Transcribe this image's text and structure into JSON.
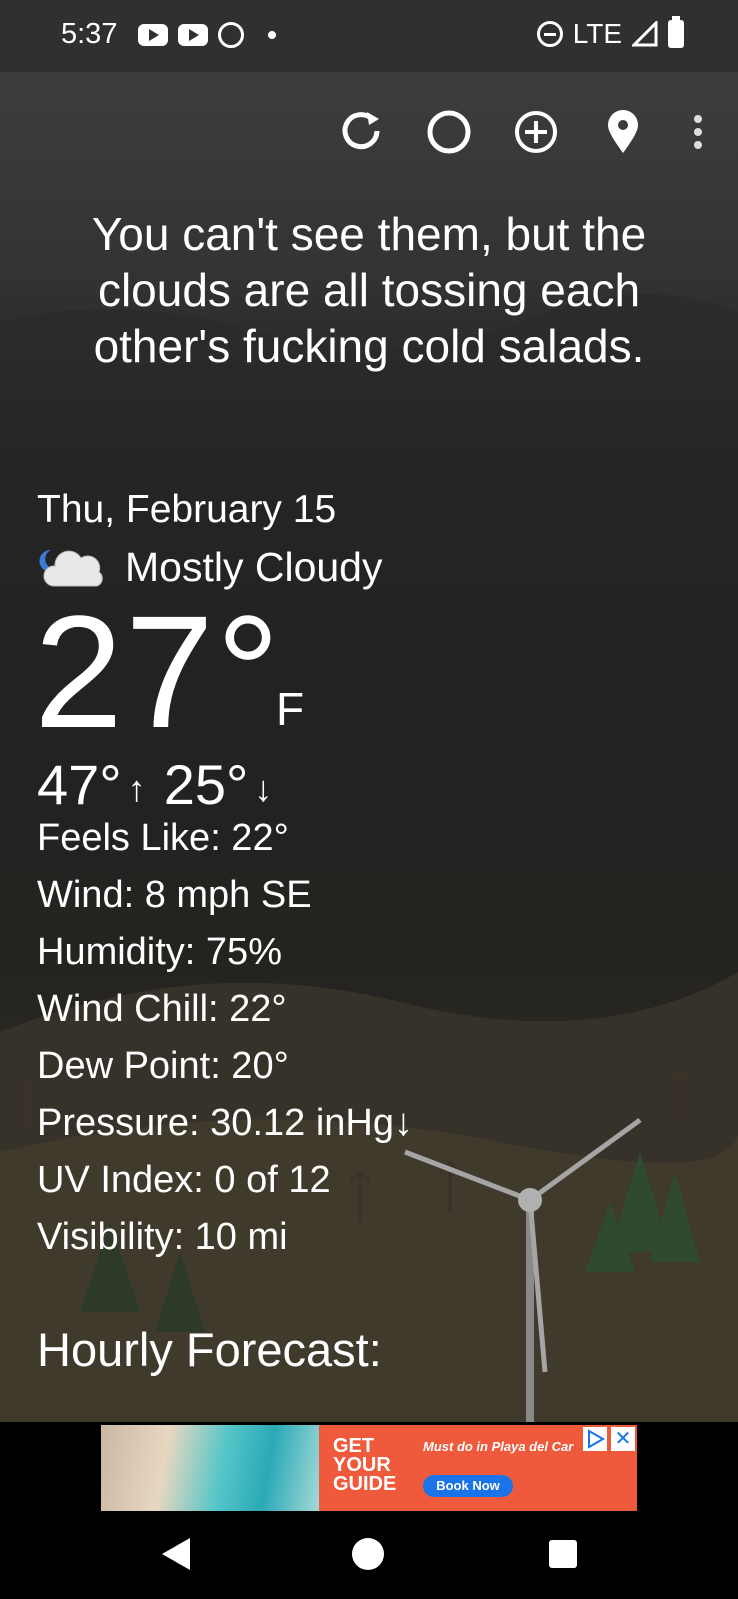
{
  "status_bar": {
    "time": "5:37",
    "network": "LTE",
    "icons": [
      "youtube-icon",
      "youtube-icon",
      "alarm-icon",
      "dot",
      "do-not-disturb-icon",
      "signal-icon",
      "battery-icon"
    ]
  },
  "toolbar": {
    "icons": [
      "refresh-icon",
      "moon-phase-icon",
      "add-location-icon",
      "location-pin-icon",
      "more-menu-icon"
    ]
  },
  "quote": "You can't see them, but the clouds are all tossing each other's fucking cold salads.",
  "weather": {
    "date": "Thu, February 15",
    "condition": "Mostly Cloudy",
    "temperature": "27°",
    "unit": "F",
    "high": "47°",
    "low": "25°",
    "high_arrow": "↑",
    "low_arrow": "↓",
    "details": [
      {
        "text": "Feels Like:  22°"
      },
      {
        "text": "Wind:  8 mph SE"
      },
      {
        "text": "Humidity:  75%"
      },
      {
        "text": "Wind Chill:  22°"
      },
      {
        "text": "Dew Point:  20°"
      },
      {
        "text": "Pressure:  30.12 inHg↓"
      },
      {
        "text": "UV Index:  0 of 12"
      },
      {
        "text": "Visibility:  10 mi"
      }
    ],
    "hourly_heading": "Hourly Forecast:"
  },
  "ad": {
    "brand_line1": "GET",
    "brand_line2": "YOUR",
    "brand_line3": "GUIDE",
    "text": "Must do in Playa del Car",
    "cta": "Book Now",
    "close": "✕"
  },
  "colors": {
    "ad_orange": "#f05a3c",
    "ad_blue": "#1a73e8",
    "status_bar": "#303030"
  }
}
